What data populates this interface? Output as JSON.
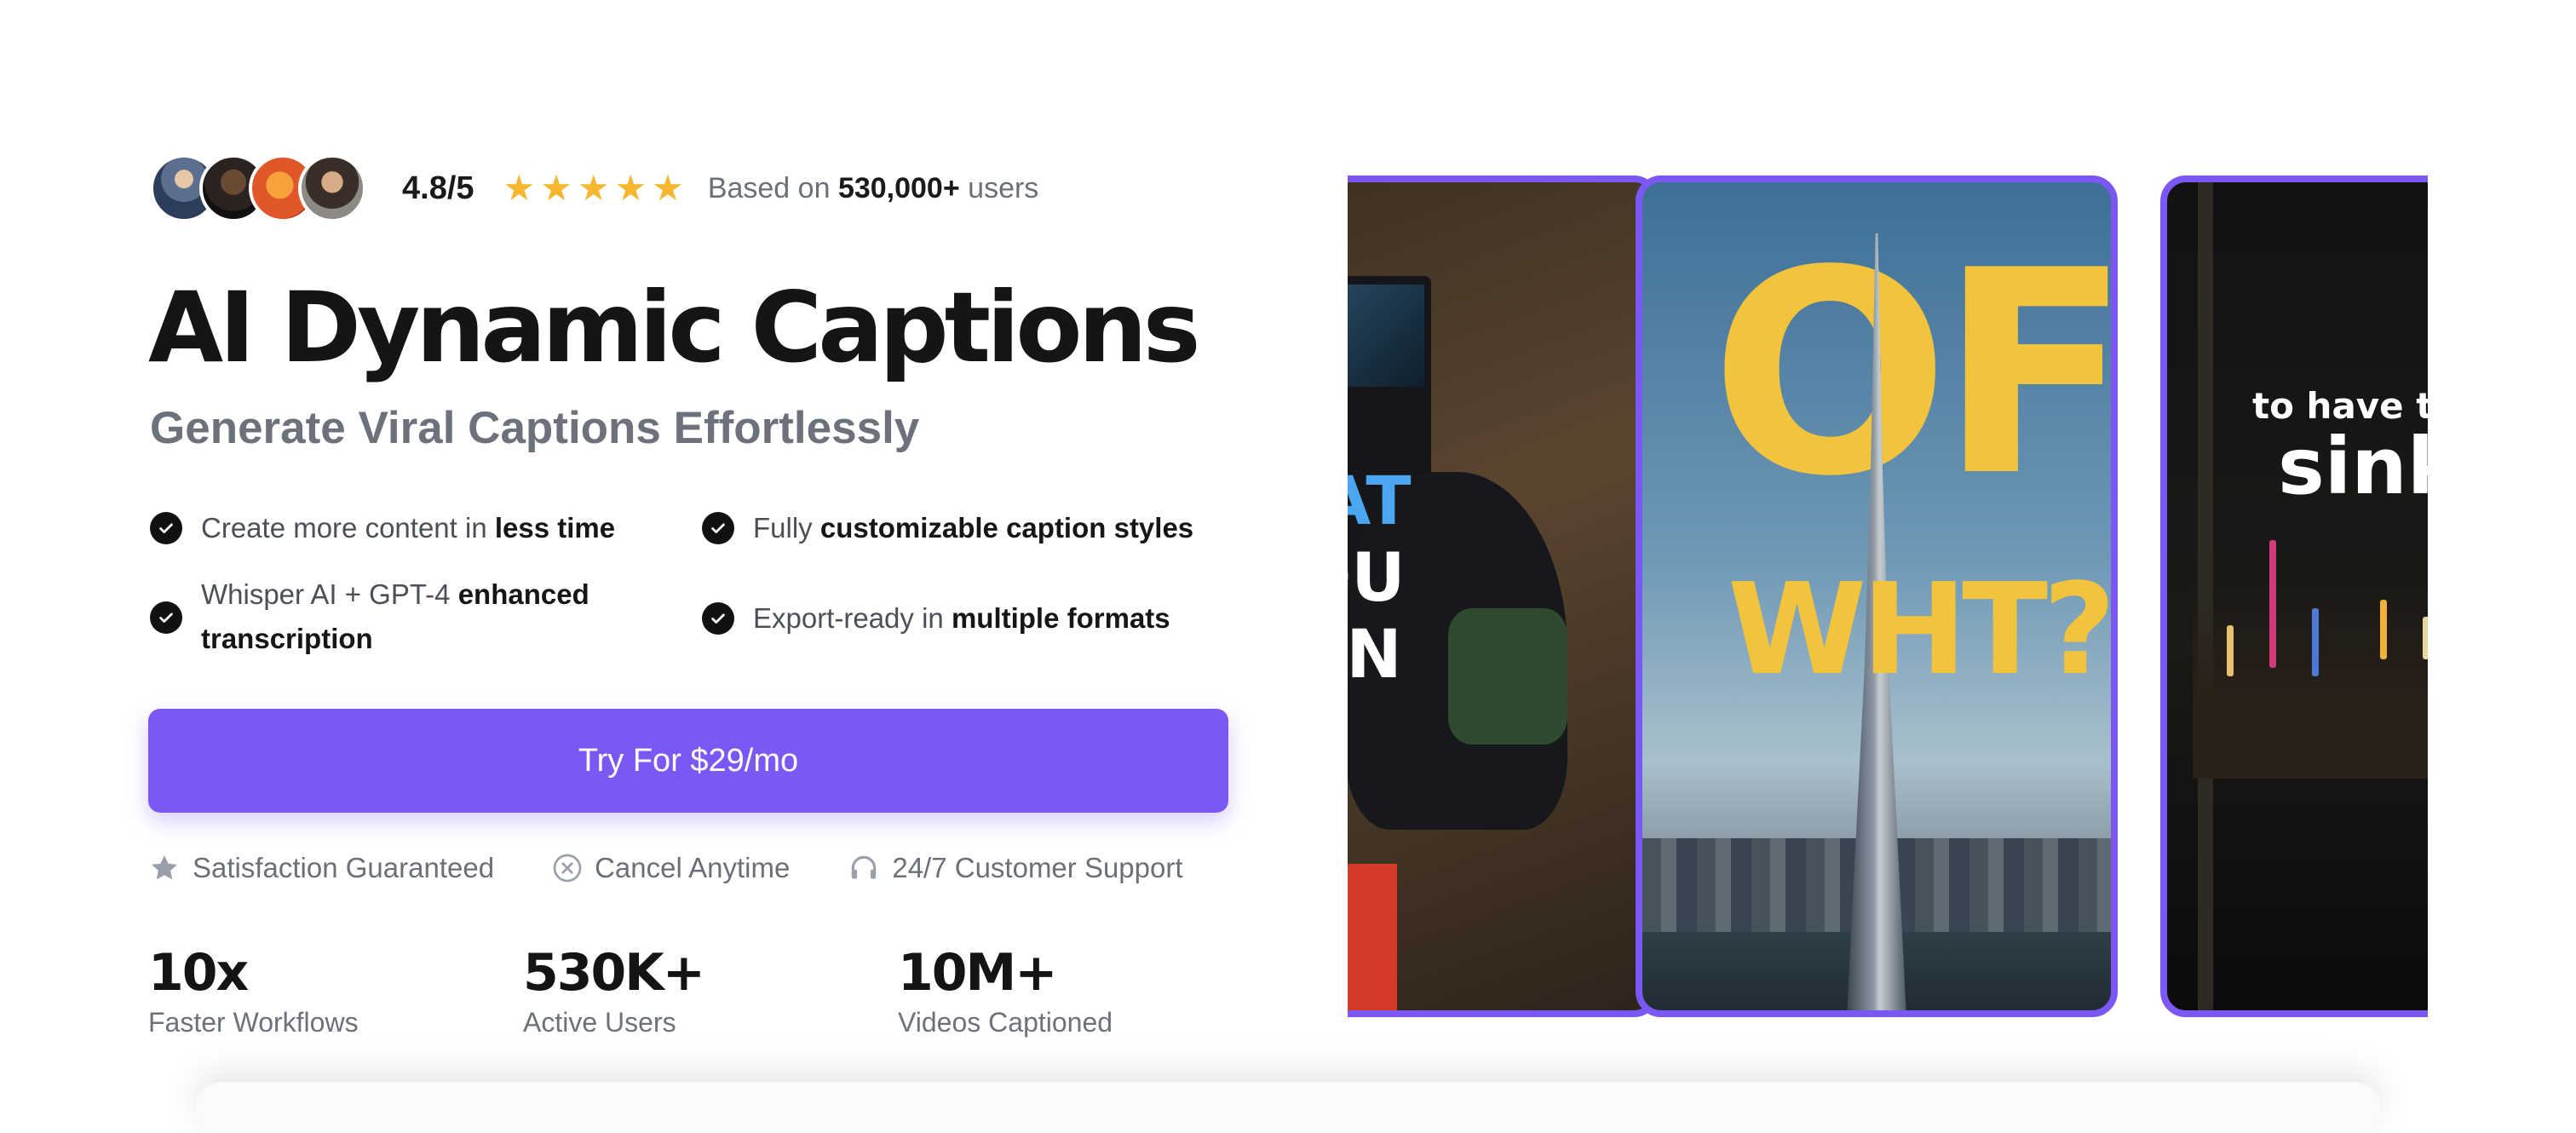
{
  "rating": {
    "score": "4.8/5",
    "stars_filled": 5,
    "based_on_prefix": "Based on",
    "based_on_count": "530,000+",
    "based_on_suffix": "users"
  },
  "hero": {
    "title": "AI Dynamic Captions",
    "subtitle": "Generate Viral Captions Effortlessly"
  },
  "features": [
    {
      "prefix": "Create more content in",
      "bold": "less time"
    },
    {
      "prefix": "Fully",
      "bold": "customizable caption styles"
    },
    {
      "prefix": "Whisper AI + GPT-4",
      "bold": "enhanced transcription"
    },
    {
      "prefix": "Export-ready in",
      "bold": "multiple formats"
    }
  ],
  "cta": {
    "label": "Try For $29/mo"
  },
  "guarantees": [
    {
      "icon": "star-icon",
      "label": "Satisfaction Guaranteed"
    },
    {
      "icon": "cancel-circle-icon",
      "label": "Cancel Anytime"
    },
    {
      "icon": "headset-icon",
      "label": "24/7 Customer Support"
    }
  ],
  "stats": [
    {
      "value": "10x",
      "label": "Faster Workflows"
    },
    {
      "value": "530K+",
      "label": "Active Users"
    },
    {
      "value": "10M+",
      "label": "Videos Captioned"
    }
  ],
  "videos": [
    {
      "caption_lines": [
        "IAT",
        "OU",
        "AN"
      ]
    },
    {
      "caption_lines": [
        "OF",
        "WHT?"
      ]
    },
    {
      "caption_lines": [
        "to have thi",
        "sink"
      ]
    }
  ],
  "colors": {
    "accent": "#7b57f3",
    "star": "#f5b630",
    "caption_yellow": "#f2c33c",
    "caption_blue": "#4aa6f0"
  }
}
